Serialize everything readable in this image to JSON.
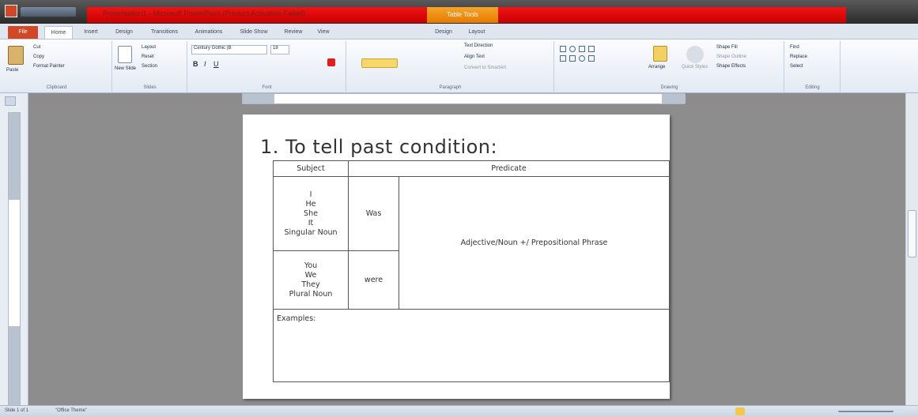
{
  "window": {
    "title": "Presentation1 - Microsoft PowerPoint (Product Activation Failed)",
    "contextual_tab_group": "Table Tools"
  },
  "tabs": [
    "File",
    "Home",
    "Insert",
    "Design",
    "Transitions",
    "Animations",
    "Slide Show",
    "Review",
    "View",
    "Design",
    "Layout"
  ],
  "ribbon": {
    "clipboard": {
      "paste": "Paste",
      "cut": "Cut",
      "copy": "Copy",
      "format_painter": "Format Painter",
      "label": "Clipboard"
    },
    "slides": {
      "new_slide": "New Slide",
      "layout": "Layout",
      "reset": "Reset",
      "section": "Section",
      "label": "Slides"
    },
    "font": {
      "name": "Century Gothic (B",
      "size": "18",
      "label": "Font"
    },
    "paragraph": {
      "text_direction": "Text Direction",
      "align_text": "Align Text",
      "smartart": "Convert to SmartArt",
      "label": "Paragraph"
    },
    "drawing": {
      "arrange": "Arrange",
      "quick_styles": "Quick Styles",
      "shape_fill": "Shape Fill",
      "shape_outline": "Shape Outline",
      "shape_effects": "Shape Effects",
      "label": "Drawing"
    },
    "editing": {
      "find": "Find",
      "replace": "Replace",
      "select": "Select",
      "label": "Editing"
    }
  },
  "slide": {
    "title": "1. To tell past condition:",
    "table": {
      "header_subject": "Subject",
      "header_predicate": "Predicate",
      "singular_subjects": [
        "I",
        "He",
        "She",
        "It",
        "Singular Noun"
      ],
      "singular_verb": "Was",
      "plural_subjects": [
        "You",
        "We",
        "They",
        "Plural Noun"
      ],
      "plural_verb": "were",
      "complement": "Adjective/Noun +/ Prepositional Phrase",
      "examples_label": "Examples:"
    }
  },
  "statusbar": {
    "slide_info": "Slide 1 of 1",
    "theme": "\"Office Theme\""
  },
  "colors": {
    "title_bar_red": "#e00000",
    "contextual_orange": "#f39c1f",
    "file_tab": "#d24726",
    "workspace": "#8d8d8d"
  }
}
